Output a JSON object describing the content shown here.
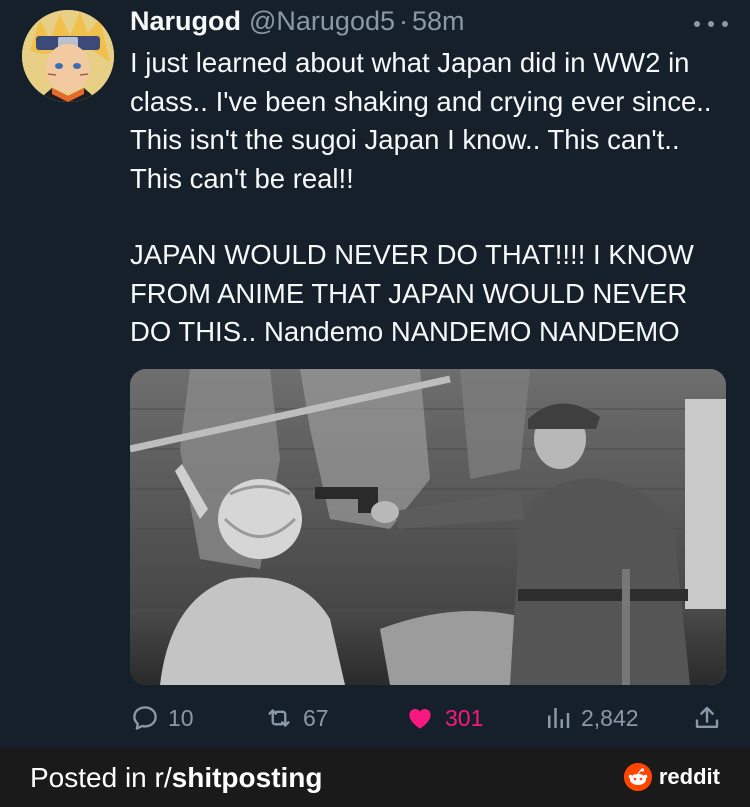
{
  "tweet": {
    "display_name": "Narugod",
    "handle": "@Narugod5",
    "separator": "·",
    "time": "58m",
    "paragraph_1": "I just learned about what Japan did in WW2 in class.. I've been shaking and crying ever since.. This isn't the sugoi Japan I know.. This can't.. This can't be real!!",
    "paragraph_2": "JAPAN WOULD NEVER DO THAT!!!! I KNOW FROM ANIME THAT JAPAN WOULD NEVER DO THIS.. Nandemo NANDEMO NANDEMO"
  },
  "actions": {
    "replies": "10",
    "retweets": "67",
    "likes": "301",
    "views": "2,842"
  },
  "icons": {
    "more": "more-horizontal-icon",
    "reply": "reply-bubble-icon",
    "retweet": "retweet-icon",
    "like": "heart-icon",
    "views": "views-bar-chart-icon",
    "share": "share-icon"
  },
  "colors": {
    "background": "#15202b",
    "secondary_text": "#8b98a5",
    "like_pink": "#f91880",
    "footer_bg": "#1a1a1b",
    "reddit_orange": "#ff4500"
  },
  "footer": {
    "posted_prefix": "Posted in r/",
    "subreddit": "shitposting",
    "brand": "reddit"
  }
}
